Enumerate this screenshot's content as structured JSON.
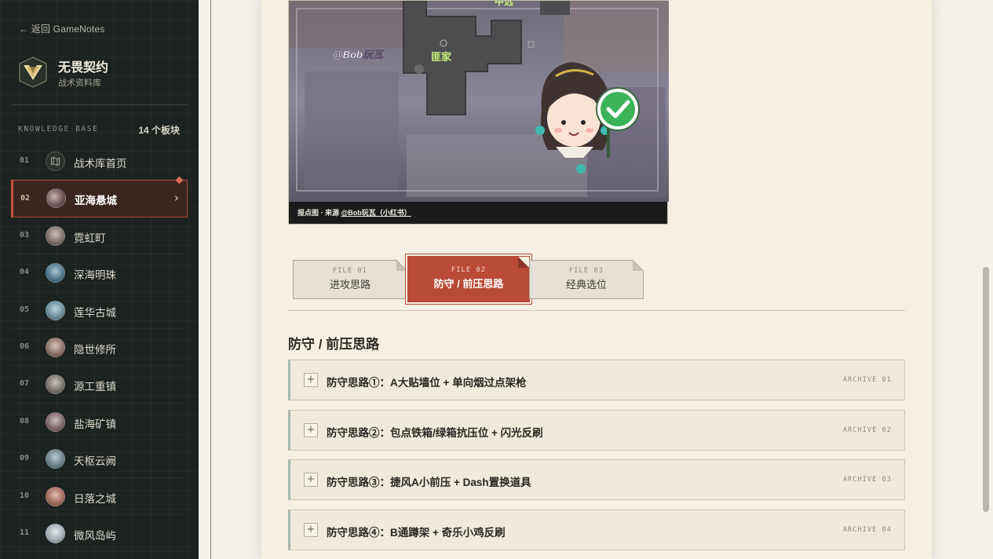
{
  "sidebar": {
    "back_link": "← 返回 GameNotes",
    "brand": {
      "title": "无畏契约",
      "subtitle": "战术资料库"
    },
    "kb_label": "KNOWLEDGE BASE",
    "kb_count": "14 个板块",
    "items": [
      {
        "num": "01",
        "label": "战术库首页",
        "icon": "map-outline-icon",
        "active": false
      },
      {
        "num": "02",
        "label": "亚海悬城",
        "icon": "map-thumb-icon",
        "active": true
      },
      {
        "num": "03",
        "label": "霓虹町",
        "icon": "map-thumb-icon",
        "active": false
      },
      {
        "num": "04",
        "label": "深海明珠",
        "icon": "map-thumb-icon",
        "active": false
      },
      {
        "num": "05",
        "label": "莲华古城",
        "icon": "map-thumb-icon",
        "active": false
      },
      {
        "num": "06",
        "label": "隐世修所",
        "icon": "map-thumb-icon",
        "active": false
      },
      {
        "num": "07",
        "label": "源工重镇",
        "icon": "map-thumb-icon",
        "active": false
      },
      {
        "num": "08",
        "label": "盐海矿镇",
        "icon": "map-thumb-icon",
        "active": false
      },
      {
        "num": "09",
        "label": "天枢云阙",
        "icon": "map-thumb-icon",
        "active": false
      },
      {
        "num": "10",
        "label": "日落之城",
        "icon": "map-thumb-icon",
        "active": false
      },
      {
        "num": "11",
        "label": "微风岛屿",
        "icon": "map-thumb-icon",
        "active": false
      }
    ]
  },
  "figure": {
    "watermark": "@Bob玩瓦",
    "map_tag_1": "中远",
    "map_tag_2": "匪家",
    "caption_prefix": "报点图 · 来源 ",
    "caption_source": "@Bob玩瓦（小红书）"
  },
  "tabs": [
    {
      "file": "FILE 01",
      "label": "进攻思路",
      "active": false
    },
    {
      "file": "FILE 02",
      "label": "防守 / 前压思路",
      "active": true
    },
    {
      "file": "FILE 03",
      "label": "经典选位",
      "active": false
    }
  ],
  "section_title": "防守 / 前压思路",
  "accordion": [
    {
      "title": "防守思路①：A大贴墙位 + 单向烟过点架枪",
      "archive": "ARCHIVE 01"
    },
    {
      "title": "防守思路②：包点铁箱/绿箱抗压位 + 闪光反刷",
      "archive": "ARCHIVE 02"
    },
    {
      "title": "防守思路③：捷风A小前压 + Dash置换道具",
      "archive": "ARCHIVE 03"
    },
    {
      "title": "防守思路④：B通蹲架 + 奇乐小鸡反刷",
      "archive": "ARCHIVE 04"
    }
  ],
  "colors": {
    "sidebar_bg": "#1c2220",
    "accent": "#b94a35",
    "paper": "#f5f0e3"
  }
}
